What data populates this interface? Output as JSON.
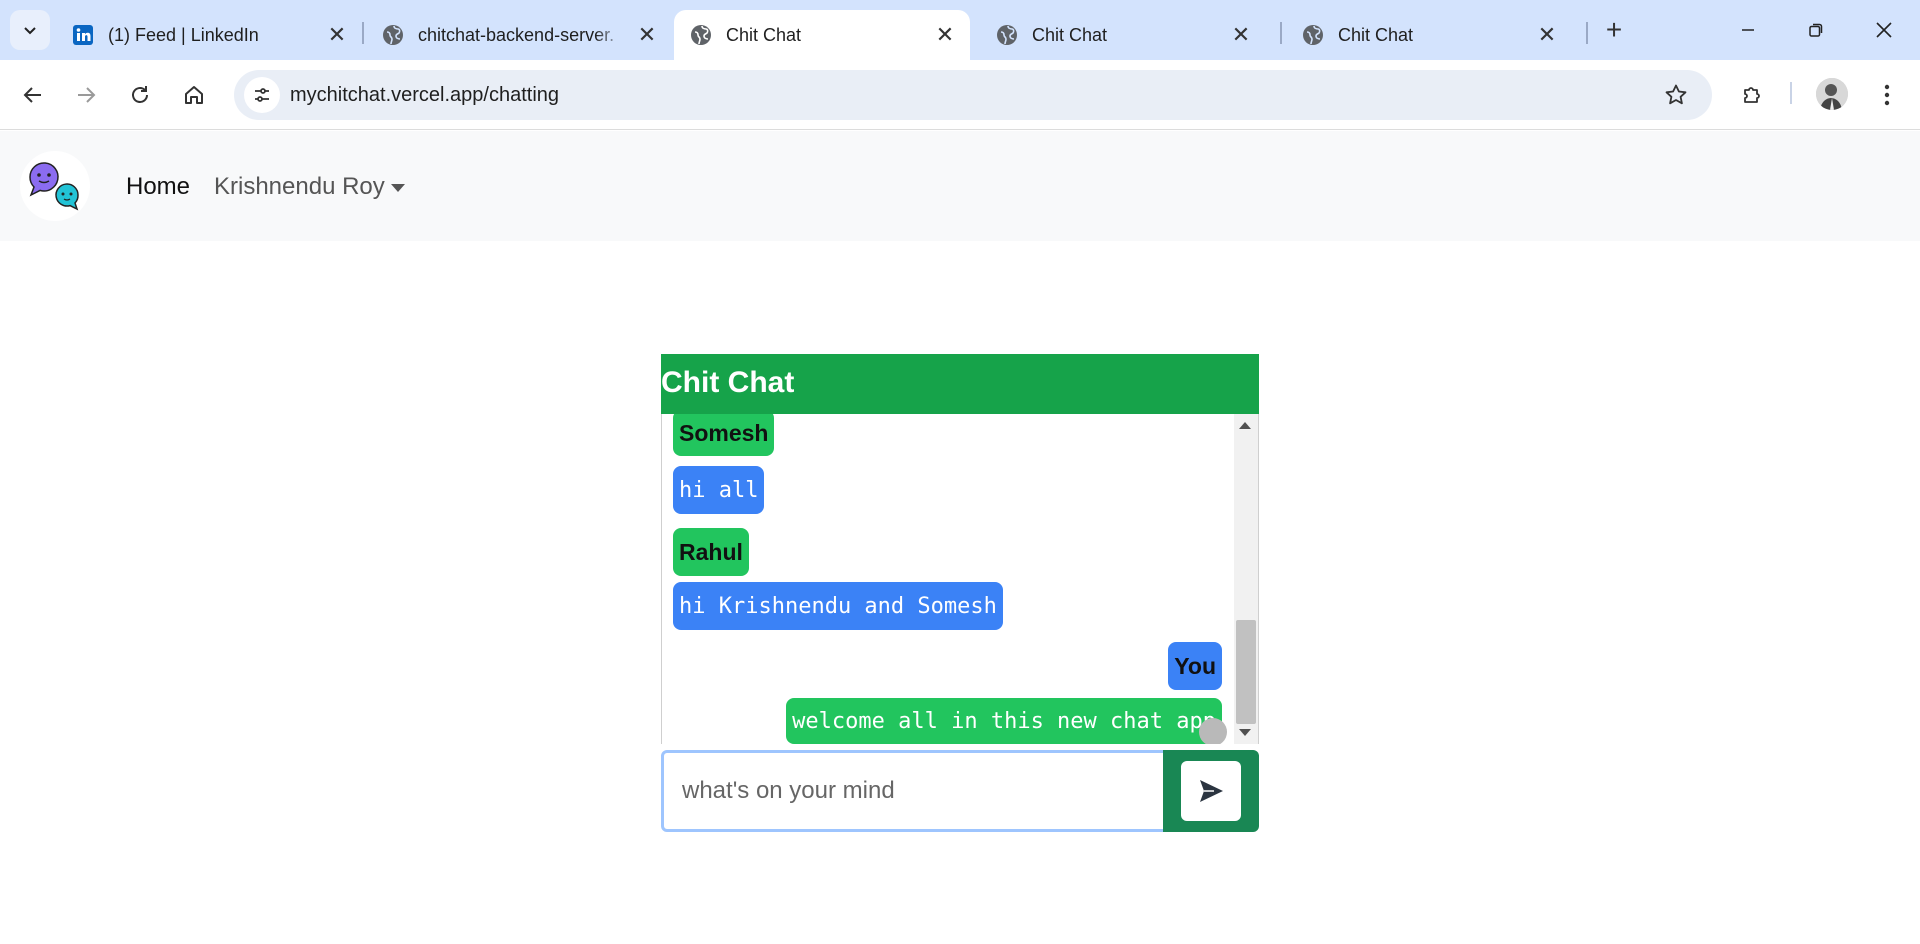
{
  "browser": {
    "tabs": [
      {
        "title": "(1) Feed | LinkedIn",
        "icon": "linkedin-icon",
        "active": false
      },
      {
        "title": "chitchat-backend-server.",
        "icon": "globe-icon",
        "active": false
      },
      {
        "title": "Chit Chat",
        "icon": "globe-icon",
        "active": true
      },
      {
        "title": "Chit Chat",
        "icon": "globe-icon",
        "active": false
      },
      {
        "title": "Chit Chat",
        "icon": "globe-icon",
        "active": false
      }
    ],
    "url": "mychitchat.vercel.app/chatting",
    "close_glyph": "✕",
    "newtab_glyph": "+"
  },
  "navbar": {
    "home": "Home",
    "user": "Krishnendu Roy"
  },
  "chat": {
    "title": "Chit Chat",
    "messages": [
      {
        "sender": "Somesh",
        "text": "hi all",
        "side": "left"
      },
      {
        "sender": "Rahul",
        "text": "hi Krishnendu and Somesh",
        "side": "left"
      },
      {
        "sender": "You",
        "text": "welcome all in this new chat app",
        "side": "right"
      }
    ],
    "input_placeholder": "what's on your mind",
    "colors": {
      "header": "#16a34a",
      "green": "#22c55e",
      "blue": "#3b82f6",
      "send": "#198754"
    }
  }
}
